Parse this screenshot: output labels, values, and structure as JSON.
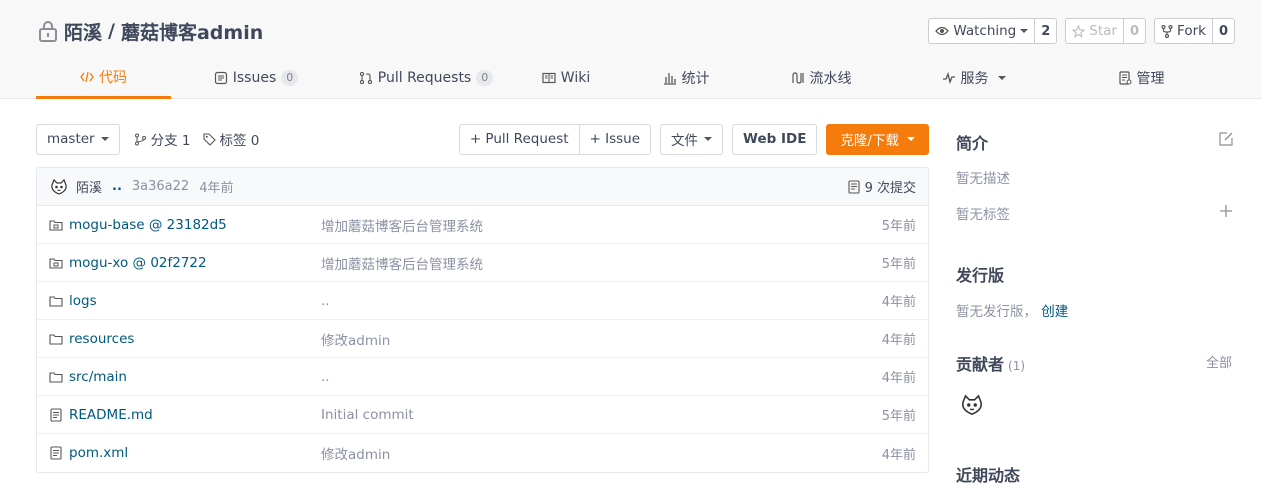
{
  "repo": {
    "owner": "陌溪",
    "separator": "/",
    "name": "蘑菇博客admin",
    "watching_label": "Watching",
    "watching_count": "2",
    "star_label": "Star",
    "star_count": "0",
    "fork_label": "Fork",
    "fork_count": "0"
  },
  "tabs": [
    {
      "label": "代码",
      "icon": "code-icon"
    },
    {
      "label": "Issues",
      "count": "0",
      "icon": "issues-icon"
    },
    {
      "label": "Pull Requests",
      "count": "0",
      "icon": "pull-request-icon"
    },
    {
      "label": "Wiki",
      "icon": "wiki-icon"
    },
    {
      "label": "统计",
      "icon": "stats-icon"
    },
    {
      "label": "流水线",
      "icon": "pipeline-icon"
    },
    {
      "label": "服务",
      "icon": "service-icon"
    },
    {
      "label": "管理",
      "icon": "manage-icon"
    }
  ],
  "toolbar": {
    "branch": "master",
    "branches_label": "分支 1",
    "tags_label": "标签 0",
    "pull_request_btn": "+ Pull Request",
    "issue_btn": "+ Issue",
    "file_btn": "文件",
    "web_ide_btn": "Web IDE",
    "clone_btn": "克隆/下载"
  },
  "commit": {
    "author": "陌溪",
    "dots": "..",
    "hash": "3a36a22",
    "time": "4年前",
    "count_label": "9 次提交"
  },
  "files": [
    {
      "name": "mogu-base @ 23182d5",
      "type": "submodule",
      "message": "增加蘑菇博客后台管理系统",
      "time": "5年前"
    },
    {
      "name": "mogu-xo @ 02f2722",
      "type": "submodule",
      "message": "增加蘑菇博客后台管理系统",
      "time": "5年前"
    },
    {
      "name": "logs",
      "type": "folder",
      "message": "..",
      "time": "4年前"
    },
    {
      "name": "resources",
      "type": "folder",
      "message": "修改admin",
      "time": "4年前"
    },
    {
      "name": "src/main",
      "type": "folder",
      "message": "..",
      "time": "4年前"
    },
    {
      "name": "README.md",
      "type": "file",
      "message": "Initial commit",
      "time": "5年前"
    },
    {
      "name": "pom.xml",
      "type": "file",
      "message": "修改admin",
      "time": "4年前"
    }
  ],
  "sidebar": {
    "intro_title": "简介",
    "no_description": "暂无描述",
    "no_tags": "暂无标签",
    "release_title": "发行版",
    "no_release": "暂无发行版，",
    "create_link": "创建",
    "contributors_title": "贡献者",
    "contributors_count": "(1)",
    "all_link": "全部",
    "activity_title": "近期动态"
  },
  "colors": {
    "accent": "#f57b0d",
    "link": "#005980",
    "muted": "#8c92a4"
  }
}
